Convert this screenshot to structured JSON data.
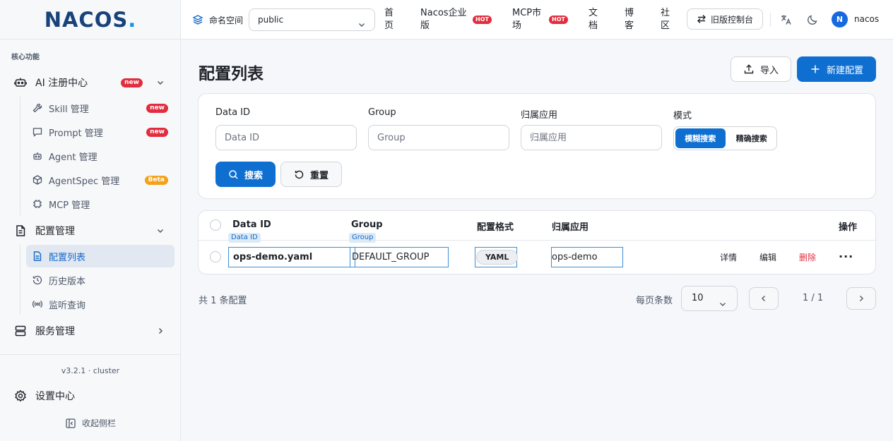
{
  "brand": {
    "logo_main": "NACOS",
    "logo_dot": "."
  },
  "sidebar": {
    "section_label": "核心功能",
    "groups": [
      {
        "label": "AI 注册中心",
        "badge": "new"
      },
      {
        "label": "配置管理"
      },
      {
        "label": "服务管理"
      }
    ],
    "ai_items": [
      {
        "label": "Skill 管理",
        "badge": "new"
      },
      {
        "label": "Prompt 管理",
        "badge": "new"
      },
      {
        "label": "Agent 管理"
      },
      {
        "label": "AgentSpec 管理",
        "badge": "Beta"
      },
      {
        "label": "MCP 管理"
      }
    ],
    "config_items": [
      {
        "label": "配置列表"
      },
      {
        "label": "历史版本"
      },
      {
        "label": "监听查询"
      }
    ],
    "version": "v3.2.1 · cluster",
    "settings": "设置中心",
    "collapse": "收起侧栏"
  },
  "topbar": {
    "namespace_label": "命名空间",
    "namespace_value": "public",
    "nav": [
      {
        "label": "首\n页"
      },
      {
        "label": "Nacos企业\n版",
        "hot": "HOT"
      },
      {
        "label": "MCP市\n场",
        "hot": "HOT"
      },
      {
        "label": "文\n档"
      },
      {
        "label": "博\n客"
      },
      {
        "label": "社\n区"
      }
    ],
    "old_console": "旧版控制台",
    "user_initial": "N",
    "username": "nacos"
  },
  "page": {
    "title": "配置列表",
    "import_btn": "导入",
    "new_btn": "新建配置"
  },
  "filters": {
    "data_id_label": "Data ID",
    "data_id_placeholder": "Data ID",
    "group_label": "Group",
    "group_placeholder": "Group",
    "app_label": "归属应用",
    "app_placeholder": "归属应用",
    "mode_label": "模式",
    "mode_fuzzy": "模糊搜索",
    "mode_exact": "精确搜索",
    "search_btn": "搜索",
    "reset_btn": "重置"
  },
  "table": {
    "headers": {
      "data_id": "Data ID",
      "group": "Group",
      "format": "配置格式",
      "app": "归属应用",
      "actions": "操作"
    },
    "rows": [
      {
        "data_id": "ops-demo.yaml",
        "group": "DEFAULT_GROUP",
        "format": "YAML",
        "app": "ops-demo",
        "tag_data_id": "Data ID",
        "tag_group": "Group",
        "actions": {
          "detail": "详情",
          "edit": "编辑",
          "delete": "删除",
          "more": "···"
        }
      }
    ]
  },
  "pagination": {
    "total": "共 1 条配置",
    "per_page_label": "每页条数",
    "per_page_value": "10",
    "page_info": "1 / 1"
  },
  "colors": {
    "primary": "#0f6fd1",
    "danger": "#e12d3e",
    "beta": "#f3a21a",
    "brand": "#18427a"
  }
}
